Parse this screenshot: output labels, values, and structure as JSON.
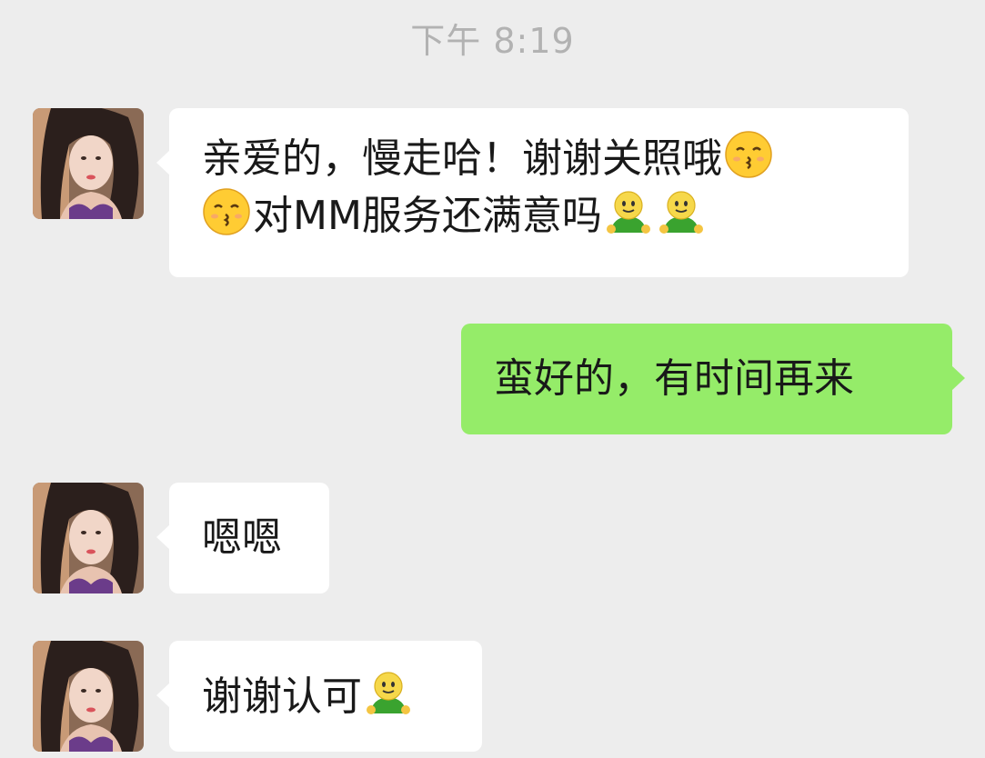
{
  "chat": {
    "timestamp": "下午 8:19",
    "messages": [
      {
        "side": "left",
        "line1": "亲爱的，慢走哈！谢谢关照哦",
        "line2": "对MM服务还满意吗"
      },
      {
        "side": "right",
        "text": "蛮好的，有时间再来"
      },
      {
        "side": "left",
        "text": "嗯嗯"
      },
      {
        "side": "left",
        "text": "谢谢认可"
      }
    ]
  },
  "icons": {
    "kiss_emoji": "kissing-face-emoji",
    "smile_emoji": "green-shirt-smile-emoji",
    "avatar": "contact-avatar"
  },
  "colors": {
    "background": "#ededed",
    "incoming_bubble": "#ffffff",
    "outgoing_bubble": "#95ec69",
    "timestamp_text": "#b2b2b2"
  }
}
